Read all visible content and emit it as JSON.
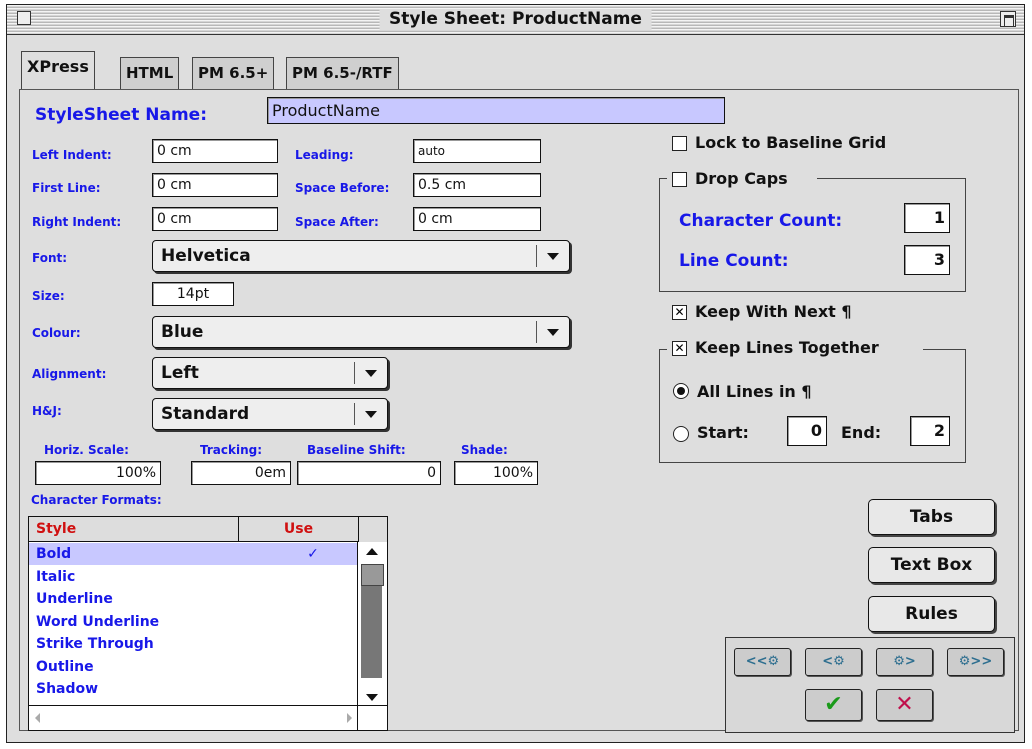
{
  "window": {
    "title": "Style Sheet: ProductName"
  },
  "tabs": [
    "XPress",
    "HTML",
    "PM 6.5+",
    "PM 6.5-/RTF"
  ],
  "stylesheet_name": {
    "label": "StyleSheet Name:",
    "value": "ProductName"
  },
  "indents": {
    "left_indent_label": "Left Indent:",
    "left_indent": "0 cm",
    "first_line_label": "First Line:",
    "first_line": "0 cm",
    "right_indent_label": "Right Indent:",
    "right_indent": "0 cm",
    "leading_label": "Leading:",
    "leading": "auto",
    "space_before_label": "Space Before:",
    "space_before": "0.5 cm",
    "space_after_label": "Space After:",
    "space_after": "0 cm"
  },
  "font": {
    "label": "Font:",
    "value": "Helvetica"
  },
  "size": {
    "label": "Size:",
    "value": "14pt"
  },
  "colour": {
    "label": "Colour:",
    "value": "Blue"
  },
  "alignment": {
    "label": "Alignment:",
    "value": "Left"
  },
  "hj": {
    "label": "H&J:",
    "value": "Standard"
  },
  "scale": {
    "horiz_label": "Horiz. Scale:",
    "horiz": "100%",
    "tracking_label": "Tracking:",
    "tracking": "0em",
    "baseline_label": "Baseline Shift:",
    "baseline": "0",
    "shade_label": "Shade:",
    "shade": "100%"
  },
  "char_formats": {
    "label": "Character Formats:",
    "col_style": "Style",
    "col_use": "Use",
    "rows": [
      {
        "style": "Bold",
        "use": "✓"
      },
      {
        "style": "Italic",
        "use": ""
      },
      {
        "style": "Underline",
        "use": ""
      },
      {
        "style": "Word Underline",
        "use": ""
      },
      {
        "style": "Strike Through",
        "use": ""
      },
      {
        "style": "Outline",
        "use": ""
      },
      {
        "style": "Shadow",
        "use": ""
      }
    ]
  },
  "options": {
    "lock_baseline": "Lock to Baseline Grid",
    "drop_caps": "Drop Caps",
    "char_count_label": "Character Count:",
    "char_count": "1",
    "line_count_label": "Line Count:",
    "line_count": "3",
    "keep_with_next": "Keep With Next ¶",
    "keep_lines_together": "Keep Lines Together",
    "all_lines": "All Lines in ¶",
    "start_label": "Start:",
    "start_value": "0",
    "end_label": "End:",
    "end_value": "2"
  },
  "buttons": {
    "tabs": "Tabs",
    "text_box": "Text Box",
    "rules": "Rules"
  },
  "nav": {
    "first": "<<⚙",
    "prev": "<⚙",
    "next": "⚙>",
    "last": "⚙>>",
    "ok": "✔",
    "cancel": "✕"
  },
  "colors": {
    "label_blue": "#1818e8",
    "header_red": "#d01010",
    "highlight": "#c8c8ff",
    "ok_green": "#1a9a1a",
    "cancel_red": "#c0104c"
  }
}
